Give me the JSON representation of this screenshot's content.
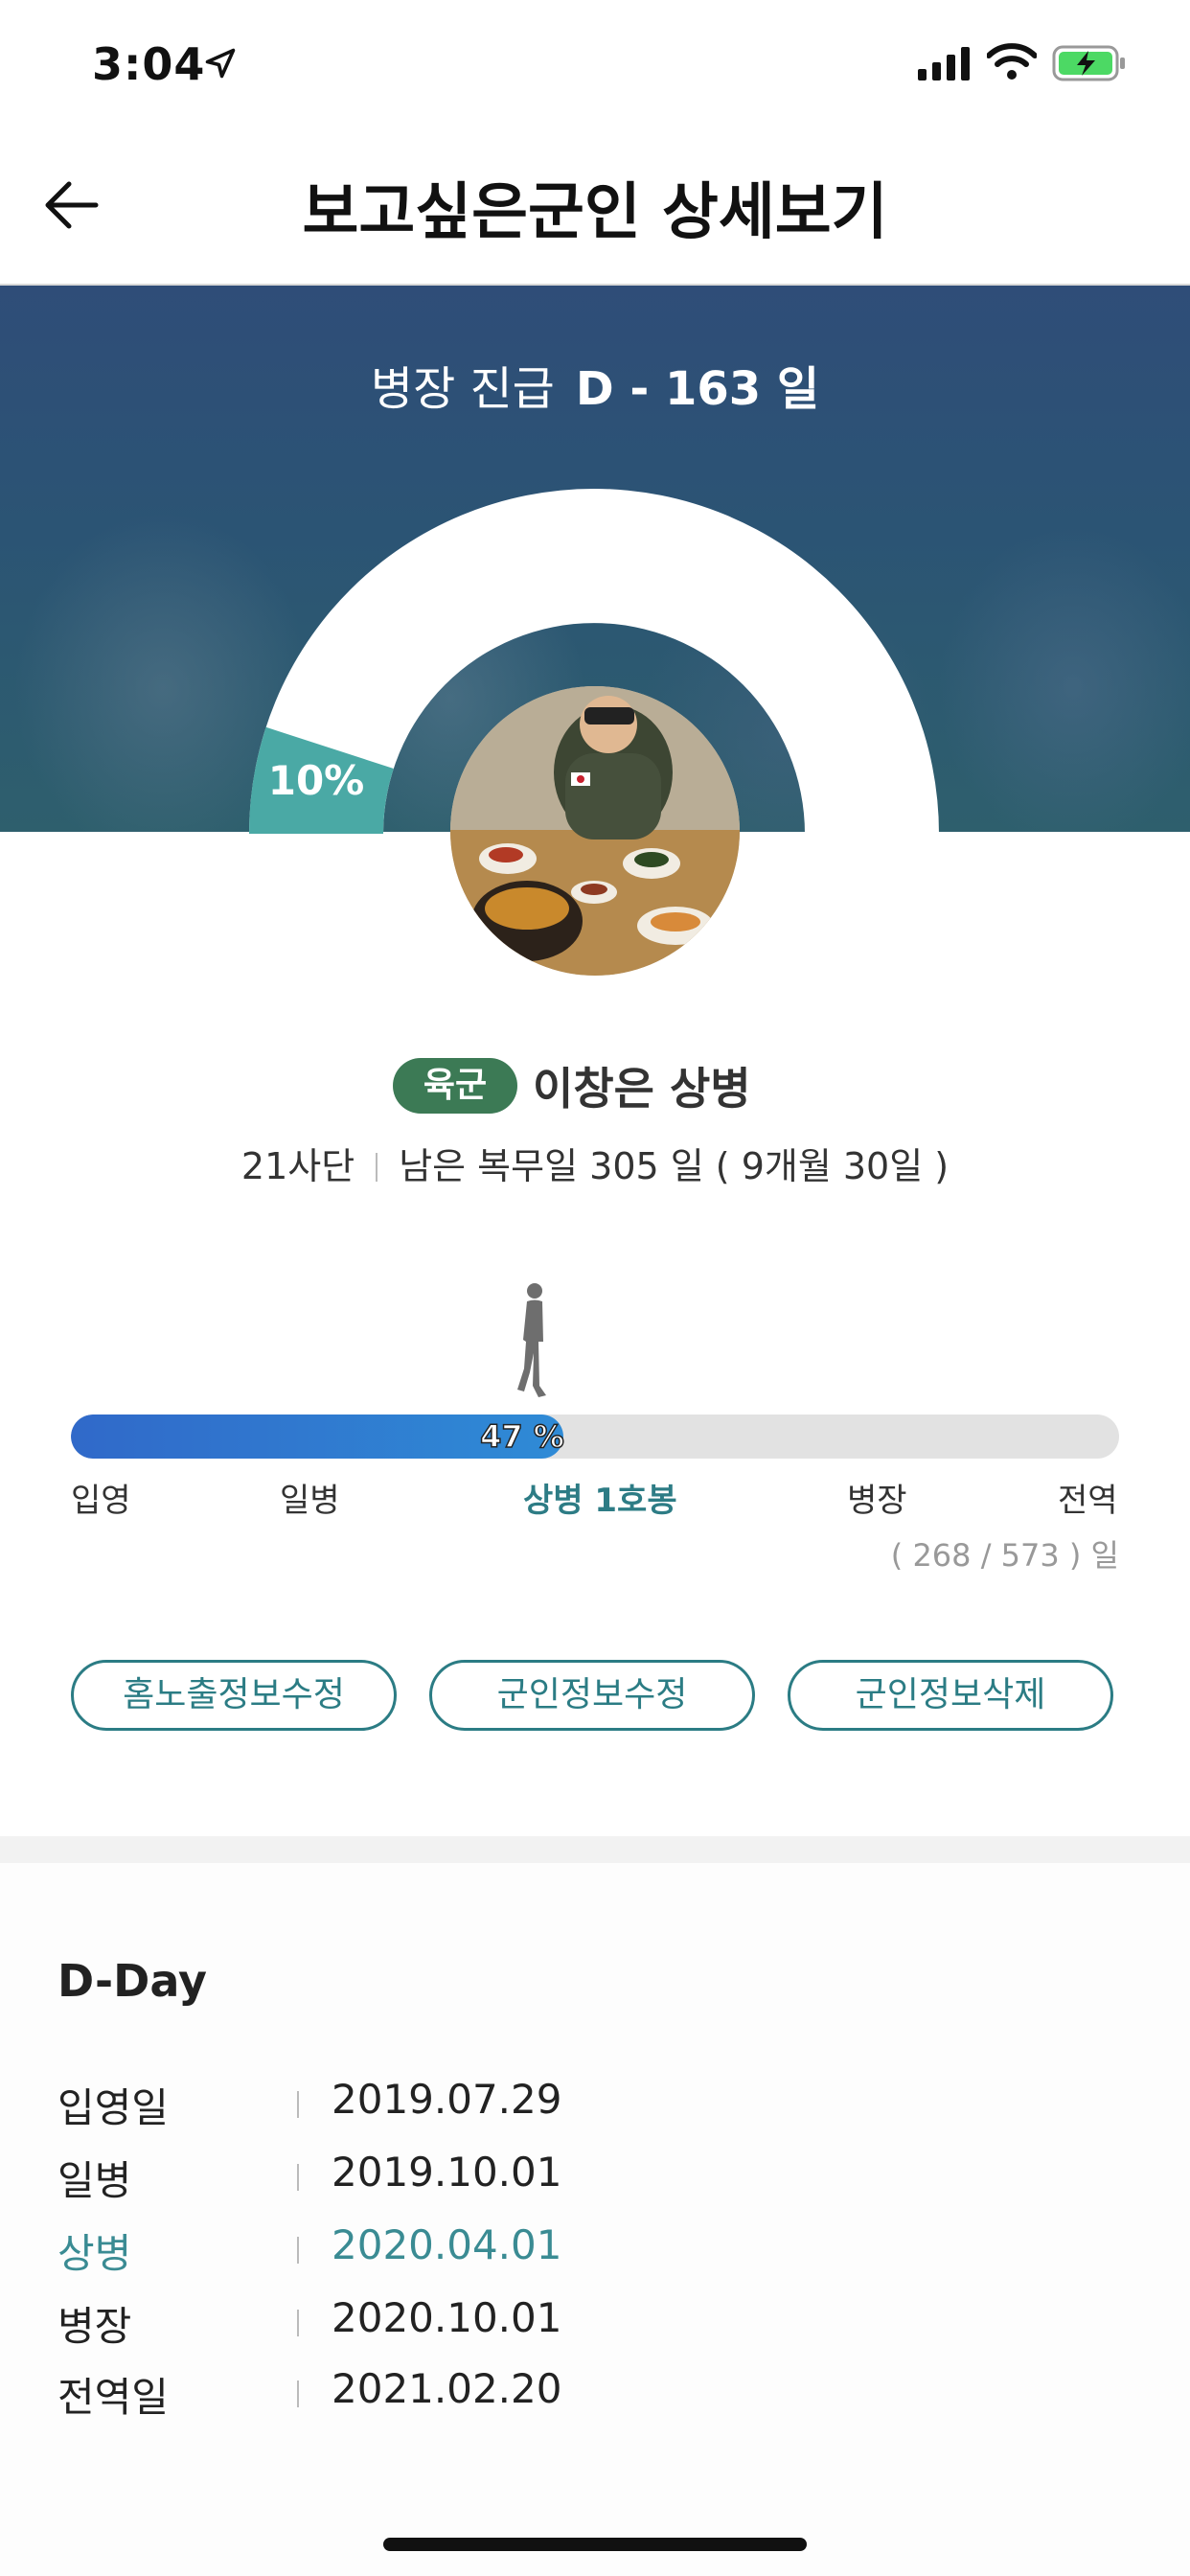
{
  "status_bar": {
    "time": "3:04"
  },
  "header": {
    "title": "보고싶은군인 상세보기"
  },
  "hero": {
    "promo_label": "병장 진급",
    "promo_dday": "D - 163 일",
    "gauge_percent_label": "10%",
    "gauge_fraction": 0.1
  },
  "profile": {
    "branch_badge": "육군",
    "name_rank": "이창은 상병",
    "unit": "21사단",
    "remaining": "남은 복무일 305 일 ( 9개월 30일 )"
  },
  "progress": {
    "percent_label": "47 %",
    "fraction": 0.47,
    "ranks": [
      {
        "label": "입영",
        "current": false
      },
      {
        "label": "일병",
        "current": false
      },
      {
        "label": "상병 1호봉",
        "current": true
      },
      {
        "label": "병장",
        "current": false
      },
      {
        "label": "전역",
        "current": false
      }
    ],
    "days_label": "( 268 / 573 ) 일"
  },
  "buttons": {
    "edit_home": "홈노출정보수정",
    "edit_info": "군인정보수정",
    "delete_info": "군인정보삭제"
  },
  "dday": {
    "title": "D-Day",
    "rows": [
      {
        "label": "입영일",
        "date": "2019.07.29",
        "highlight": false
      },
      {
        "label": "일병",
        "date": "2019.10.01",
        "highlight": false
      },
      {
        "label": "상병",
        "date": "2020.04.01",
        "highlight": true
      },
      {
        "label": "병장",
        "date": "2020.10.01",
        "highlight": false
      },
      {
        "label": "전역일",
        "date": "2021.02.20",
        "highlight": false
      }
    ]
  },
  "colors": {
    "accent": "#2b7c84",
    "badge": "#3c7a55",
    "progress": "#3069c9",
    "gauge_fill": "#4aa9a5"
  }
}
